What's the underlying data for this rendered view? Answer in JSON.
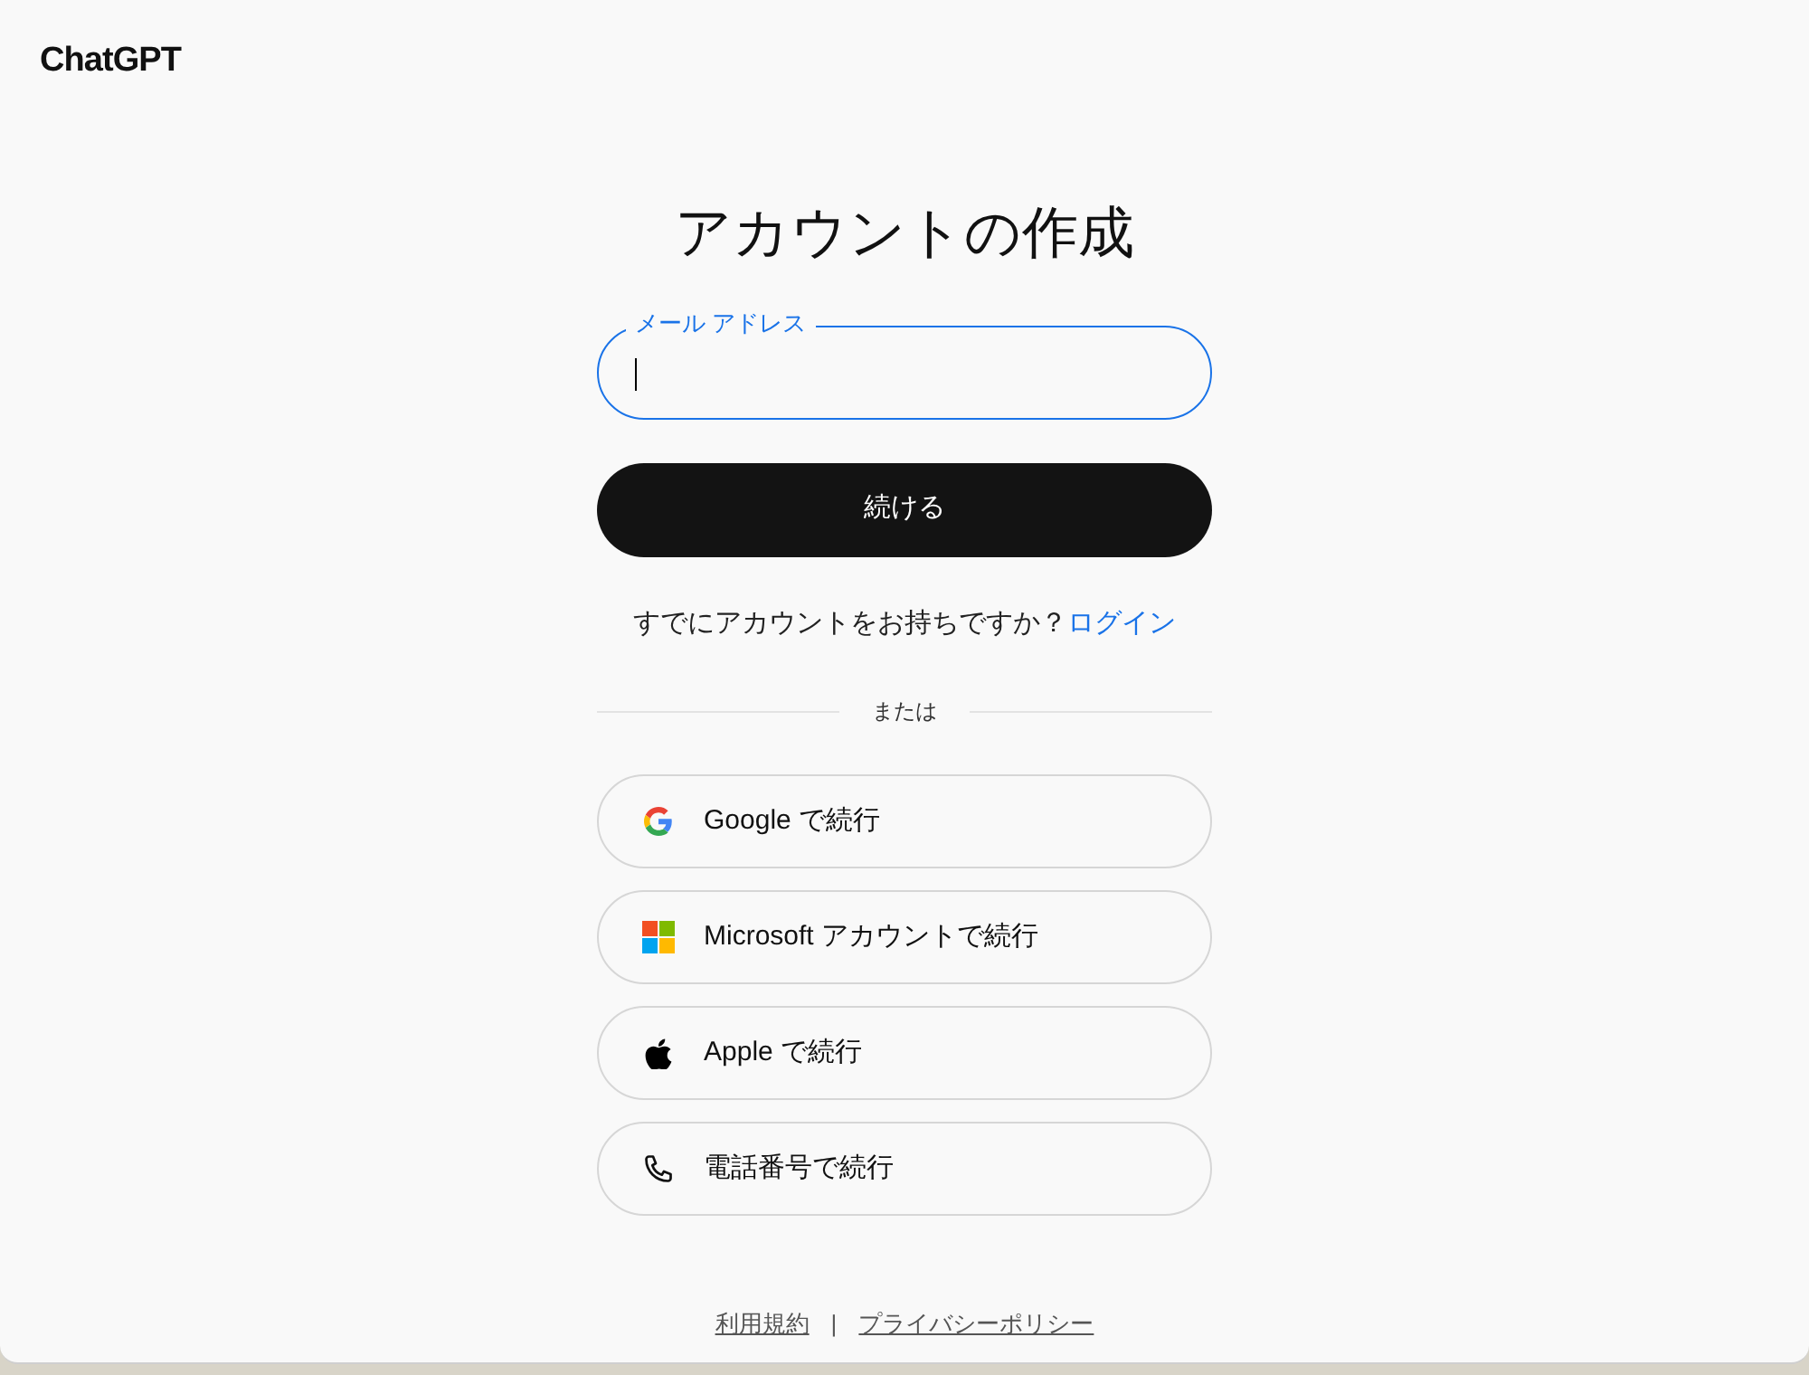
{
  "logo": "ChatGPT",
  "title": "アカウントの作成",
  "email_field": {
    "label": "メール アドレス",
    "focused": true
  },
  "continue_button": "続ける",
  "login_prompt": {
    "text": "すでにアカウントをお持ちですか？",
    "link": "ログイン"
  },
  "divider": "または",
  "providers": [
    {
      "kind": "google",
      "label": "Google で続行"
    },
    {
      "kind": "microsoft",
      "label": "Microsoft アカウントで続行"
    },
    {
      "kind": "apple",
      "label": "Apple で続行"
    },
    {
      "kind": "phone",
      "label": "電話番号で続行"
    }
  ],
  "footer_links": [
    "利用規約",
    "プライバシーポリシー"
  ],
  "footer_separator": "|"
}
